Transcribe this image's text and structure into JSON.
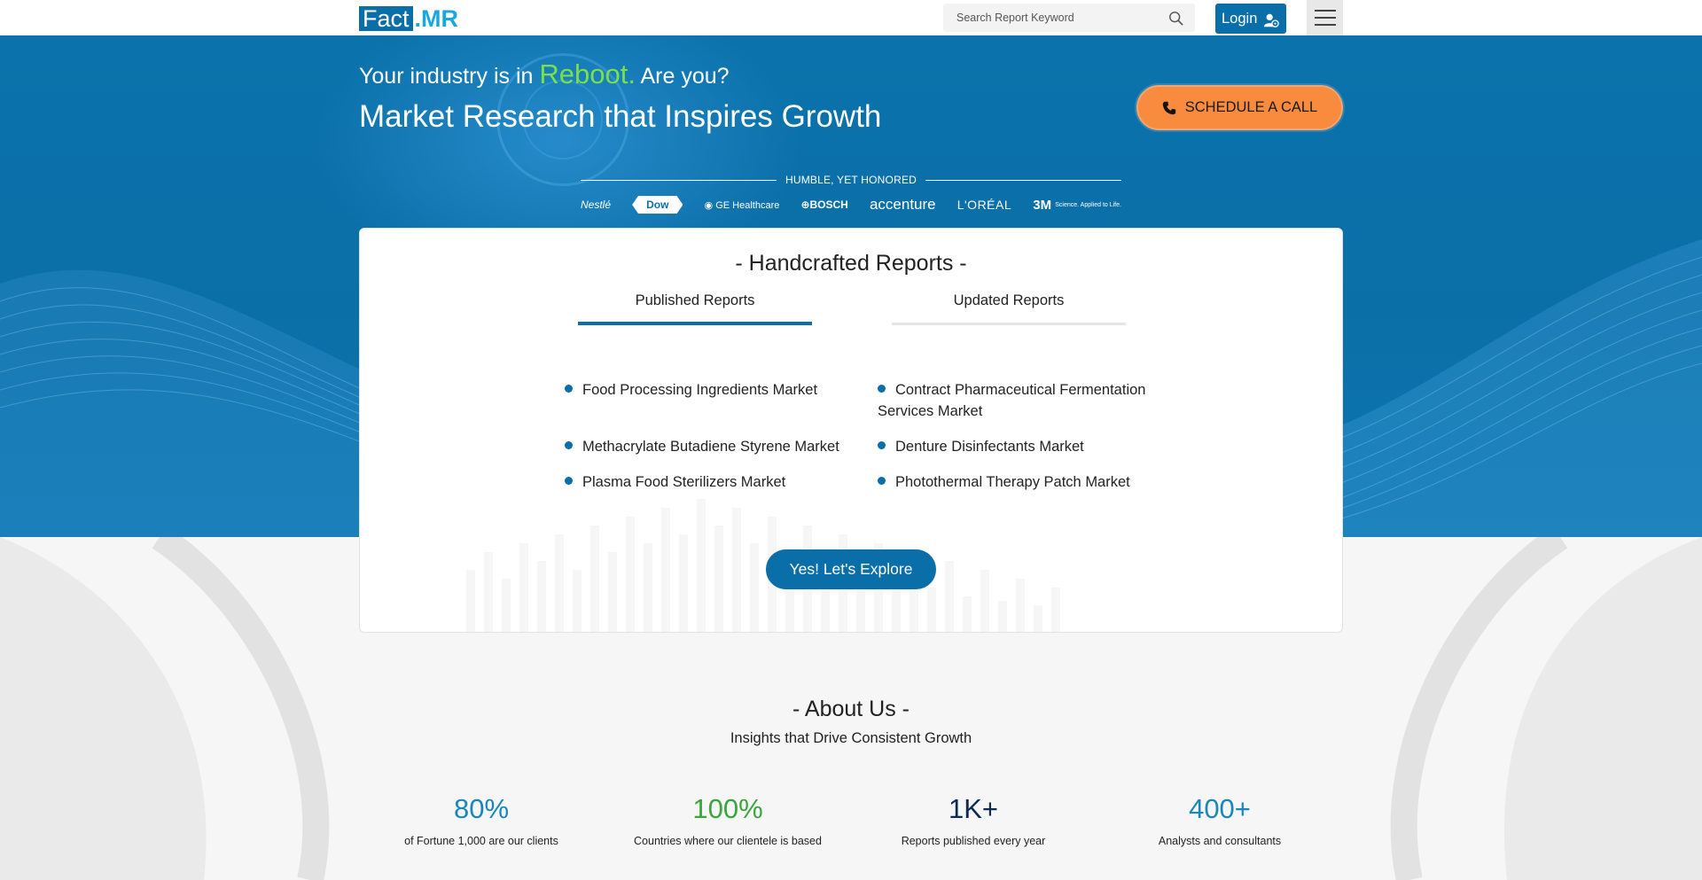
{
  "header": {
    "logo_part1": "Fact",
    "logo_part2": ".MR",
    "search_placeholder": "Search Report Keyword",
    "login_label": "Login"
  },
  "hero": {
    "tagline_prefix": "Your industry is in ",
    "tagline_highlight": "Reboot.",
    "tagline_suffix": " Are you?",
    "headline": "Market Research that Inspires Growth",
    "schedule_label": "SCHEDULE A CALL",
    "honored_label": "HUMBLE, YET HONORED",
    "clients": [
      "Nestlé",
      "Dow",
      "GE Healthcare",
      "BOSCH",
      "accenture",
      "L'ORÉAL",
      "3M"
    ],
    "client_3m_tagline": "Science. Applied to Life."
  },
  "reports": {
    "title": "- Handcrafted Reports -",
    "tabs": [
      {
        "label": "Published Reports",
        "active": true
      },
      {
        "label": "Updated Reports",
        "active": false
      }
    ],
    "items_left": [
      "Food Processing Ingredients Market",
      "Methacrylate Butadiene Styrene Market",
      "Plasma Food Sterilizers Market"
    ],
    "items_right": [
      "Contract Pharmaceutical Fermentation Services Market",
      "Denture Disinfectants Market",
      "Photothermal Therapy Patch Market"
    ],
    "explore_label": "Yes! Let's Explore"
  },
  "about": {
    "title": "- About Us -",
    "subtitle": "Insights that Drive Consistent Growth",
    "stats": [
      {
        "value": "80%",
        "label": "of Fortune 1,000 are our clients",
        "color": "#1a87b8"
      },
      {
        "value": "100%",
        "label": "Countries where our clientele is based",
        "color": "#3aa53a"
      },
      {
        "value": "1K+",
        "label": "Reports published every year",
        "color": "#0d2a55"
      },
      {
        "value": "400+",
        "label": "Analysts and consultants",
        "color": "#1a87b8"
      }
    ]
  },
  "colors": {
    "brand": "#0a6fa8",
    "accent_orange": "#f98b3f",
    "reboot_green": "#7ae04a"
  },
  "icons": {
    "search": "search-icon",
    "login": "user-icon",
    "menu": "hamburger-menu-icon",
    "phone": "phone-icon"
  }
}
